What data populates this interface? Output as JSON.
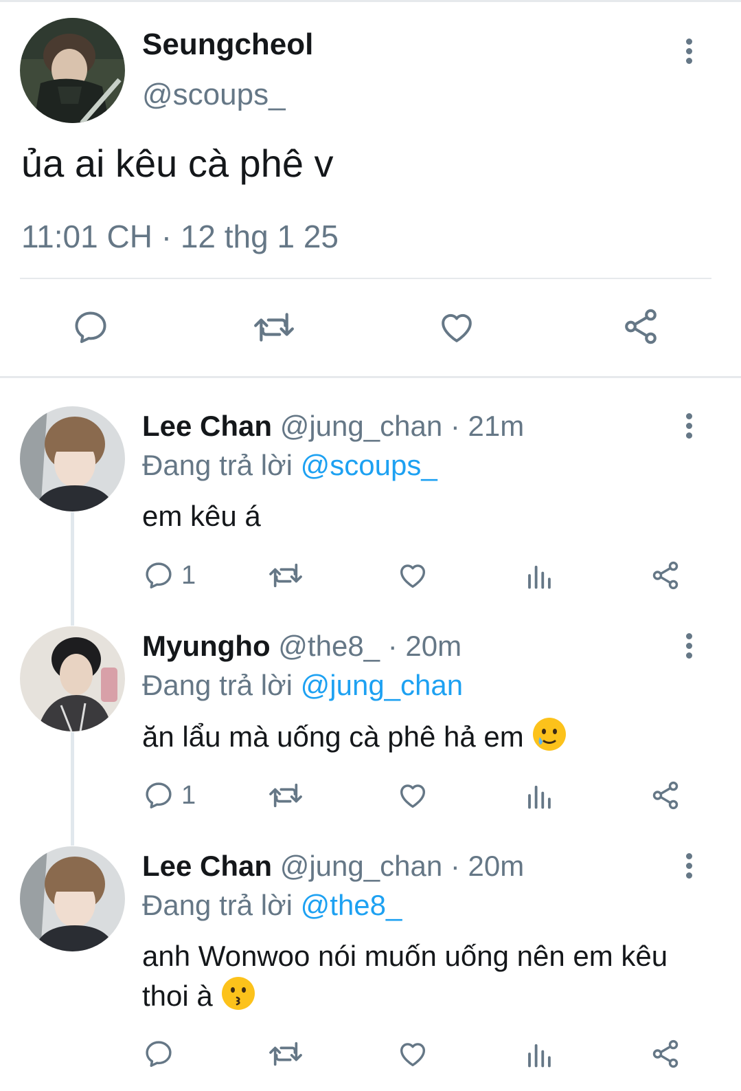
{
  "main_tweet": {
    "name": "Seungcheol",
    "handle": "@scoups_",
    "text": "ủa ai kêu cà phê v",
    "time": "11:01 CH",
    "separator": "·",
    "date": "12 thg 1 25"
  },
  "replies": [
    {
      "name": "Lee Chan",
      "handle": "@jung_chan",
      "age": "· 21m",
      "replying_label": "Đang trả lời",
      "replying_to": "@scoups_",
      "text": "em kêu á",
      "emoji": "",
      "reply_count": "1"
    },
    {
      "name": "Myungho",
      "handle": "@the8_",
      "age": "· 20m",
      "replying_label": "Đang trả lời",
      "replying_to": "@jung_chan",
      "text": "ăn lẩu mà uống cà phê hả em",
      "emoji": "smiling-face-with-tear",
      "reply_count": "1"
    },
    {
      "name": "Lee Chan",
      "handle": "@jung_chan",
      "age": "· 20m",
      "replying_label": "Đang trả lời",
      "replying_to": "@the8_",
      "text": "anh Wonwoo nói muốn uống nên em kêu thoi à",
      "emoji": "kissing-face",
      "reply_count": ""
    }
  ],
  "icons": {
    "reply": "comment-icon",
    "retweet": "retweet-icon",
    "like": "heart-icon",
    "share": "share-icon",
    "analytics": "analytics-icon",
    "more": "more-vertical-icon"
  },
  "colors": {
    "text": "#14171a",
    "secondary": "#657786",
    "link": "#1da1f2",
    "divider": "#e6e9ec"
  }
}
